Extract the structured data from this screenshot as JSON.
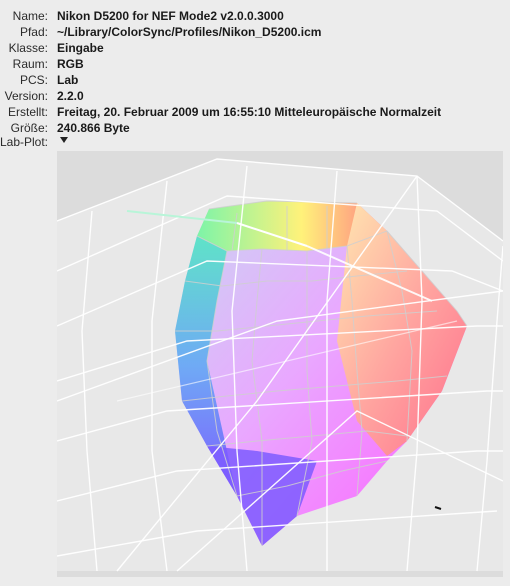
{
  "info": [
    {
      "label": "Name:",
      "value": "Nikon D5200 for NEF Mode2 v2.0.0.3000"
    },
    {
      "label": "Pfad:",
      "value": "~/Library/ColorSync/Profiles/Nikon_D5200.icm"
    },
    {
      "label": "Klasse:",
      "value": "Eingabe"
    },
    {
      "label": "Raum:",
      "value": "RGB"
    },
    {
      "label": "PCS:",
      "value": "Lab"
    },
    {
      "label": "Version:",
      "value": "2.2.0"
    },
    {
      "label": "Erstellt:",
      "value": "Freitag, 20. Februar 2009 um 16:55:10 Mitteleuropäische Normalzeit"
    },
    {
      "label": "Größe:",
      "value": "240.866 Byte"
    }
  ],
  "plot": {
    "label": "Lab-Plot:",
    "menu_icon": "disclosure-triangle-down-icon",
    "background": "#dcdcdc",
    "gamut_colors": [
      "#7df4a8",
      "#fff27a",
      "#ff7b86",
      "#7d5cff",
      "#ff5cff",
      "#5c9dff"
    ]
  }
}
